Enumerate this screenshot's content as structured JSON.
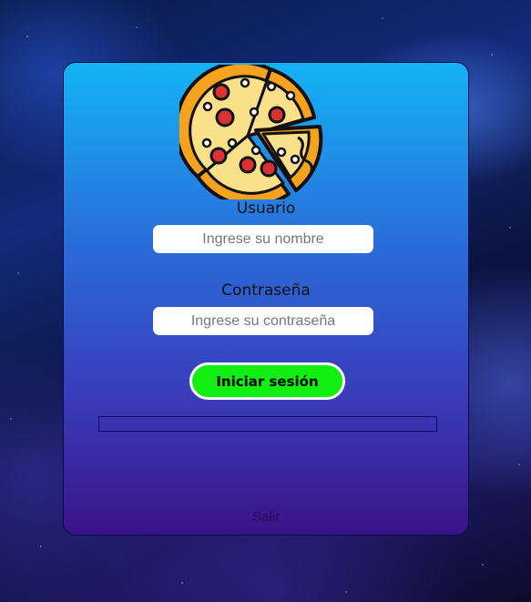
{
  "background": {
    "style": "space-nebula"
  },
  "login_card": {
    "logo_icon": "pizza-icon",
    "username": {
      "label": "Usuario",
      "value": "",
      "placeholder": "Ingrese su nombre"
    },
    "password": {
      "label": "Contraseña",
      "value": "",
      "placeholder": "Ingrese su contraseña"
    },
    "login_button_label": "Iniciar sesión",
    "login_button_color": "#11ee11",
    "progress": 0,
    "exit_label": "Salir"
  }
}
